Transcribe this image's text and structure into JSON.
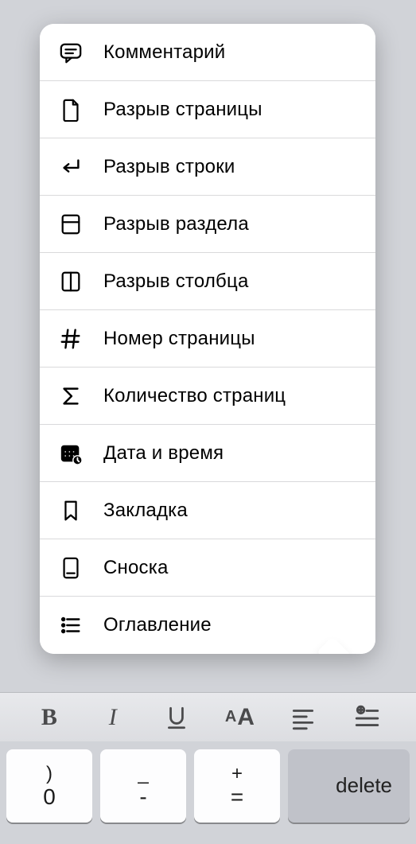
{
  "menu": {
    "items": [
      {
        "icon": "comment-icon",
        "label": "Комментарий"
      },
      {
        "icon": "page-break-icon",
        "label": "Разрыв страницы"
      },
      {
        "icon": "line-break-icon",
        "label": "Разрыв строки"
      },
      {
        "icon": "section-break-icon",
        "label": "Разрыв раздела"
      },
      {
        "icon": "column-break-icon",
        "label": "Разрыв столбца"
      },
      {
        "icon": "hash-icon",
        "label": "Номер страницы"
      },
      {
        "icon": "sigma-icon",
        "label": "Количество страниц"
      },
      {
        "icon": "calendar-icon",
        "label": "Дата и время"
      },
      {
        "icon": "bookmark-icon",
        "label": "Закладка"
      },
      {
        "icon": "footnote-icon",
        "label": "Сноска"
      },
      {
        "icon": "toc-icon",
        "label": "Оглавление"
      }
    ]
  },
  "toolbar": {
    "bold": "B",
    "italic": "I",
    "underline": "U",
    "text_size": "AA"
  },
  "keyboard": {
    "keys": [
      {
        "top": ")",
        "bot": "0"
      },
      {
        "top": "_",
        "bot": "-"
      },
      {
        "top": "+",
        "bot": "="
      }
    ],
    "delete": "delete"
  }
}
